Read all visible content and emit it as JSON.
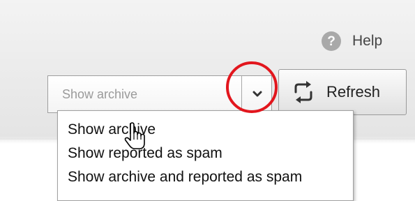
{
  "toolbar": {
    "help_label": "Help",
    "help_icon_glyph": "?",
    "refresh_label": "Refresh"
  },
  "filter_select": {
    "selected_value": "Show archive",
    "options": [
      "Show archive",
      "Show reported as spam",
      "Show archive and reported as spam"
    ]
  },
  "icons": {
    "help": "question-circle-icon",
    "dropdown": "chevron-down-icon",
    "refresh": "refresh-icon",
    "cursor": "hand-pointer-icon"
  },
  "colors": {
    "highlight_circle": "#e2161d",
    "help_icon": "#a9a9a9",
    "placeholder_text": "#9a9a9a"
  }
}
